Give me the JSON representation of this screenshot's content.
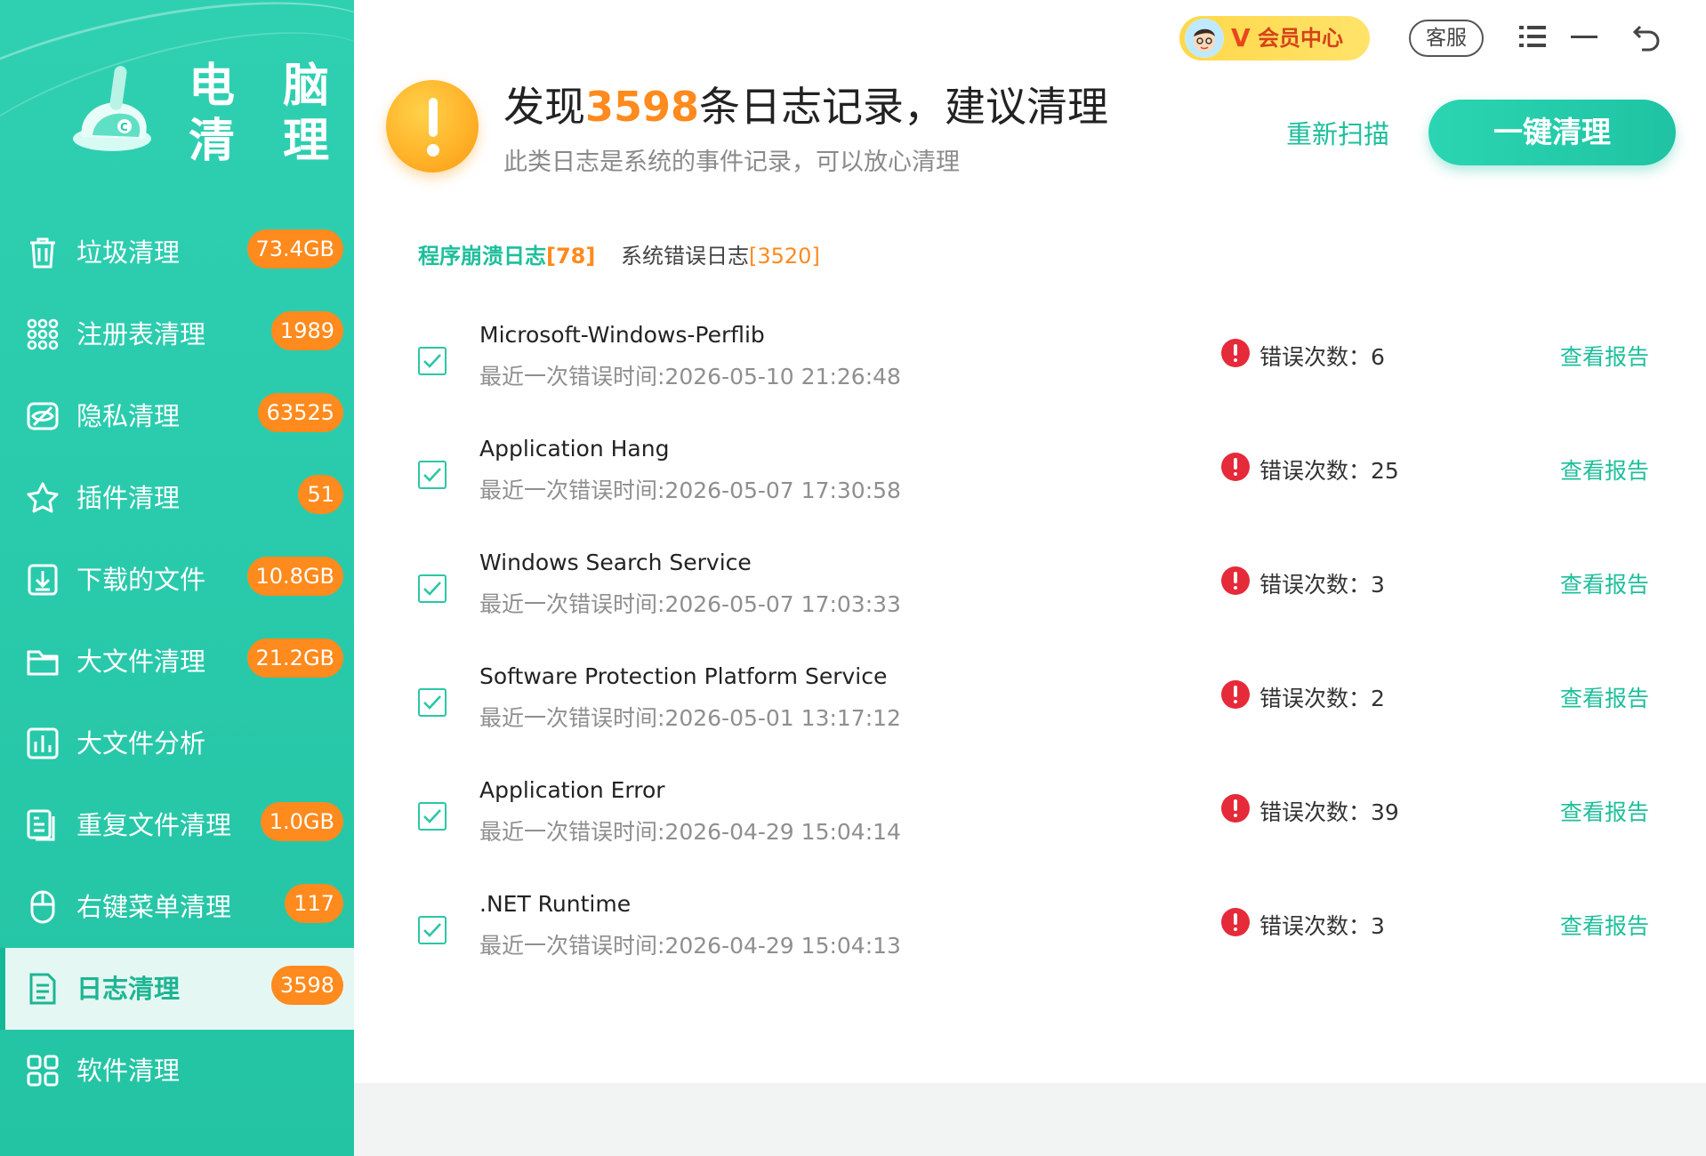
{
  "app": {
    "logo_text_line1": "电 脑",
    "logo_text_line2": "清 理"
  },
  "sidebar": {
    "items": [
      {
        "label": "垃圾清理",
        "badge": "73.4GB",
        "icon": "trash-icon"
      },
      {
        "label": "注册表清理",
        "badge": "1989",
        "icon": "registry-grid-icon"
      },
      {
        "label": "隐私清理",
        "badge": "63525",
        "icon": "privacy-eye-icon"
      },
      {
        "label": "插件清理",
        "badge": "51",
        "icon": "puzzle-icon"
      },
      {
        "label": "下载的文件",
        "badge": "10.8GB",
        "icon": "download-icon"
      },
      {
        "label": "大文件清理",
        "badge": "21.2GB",
        "icon": "folder-icon"
      },
      {
        "label": "大文件分析",
        "badge": "",
        "icon": "bar-chart-icon"
      },
      {
        "label": "重复文件清理",
        "badge": "1.0GB",
        "icon": "duplicate-file-icon"
      },
      {
        "label": "右键菜单清理",
        "badge": "117",
        "icon": "mouse-icon"
      },
      {
        "label": "日志清理",
        "badge": "3598",
        "icon": "log-document-icon",
        "active": true
      },
      {
        "label": "软件清理",
        "badge": "",
        "icon": "apps-grid-icon"
      }
    ]
  },
  "topbar": {
    "vip_mark": "V",
    "vip_label": "会员中心",
    "service_label": "客服",
    "icons": [
      "menu-icon",
      "minimize-icon",
      "back-icon"
    ]
  },
  "header": {
    "headline_prefix": "发现",
    "headline_count": "3598",
    "headline_suffix": "条日志记录，建议清理",
    "subline": "此类日志是系统的事件记录，可以放心清理",
    "rescan_label": "重新扫描",
    "clean_label": "一键清理"
  },
  "tabs": [
    {
      "label": "程序崩溃日志",
      "count": "[78]",
      "active": true
    },
    {
      "label": "系统错误日志",
      "count": "[3520]",
      "active": false
    }
  ],
  "log_rows": [
    {
      "name": "Microsoft-Windows-Perflib",
      "time": "最近一次错误时间:2026-05-10 21:26:48",
      "error_label": "错误次数：6",
      "report_label": "查看报告",
      "checked": true
    },
    {
      "name": "Application Hang",
      "time": "最近一次错误时间:2026-05-07 17:30:58",
      "error_label": "错误次数：25",
      "report_label": "查看报告",
      "checked": true
    },
    {
      "name": "Windows Search Service",
      "time": "最近一次错误时间:2026-05-07 17:03:33",
      "error_label": "错误次数：3",
      "report_label": "查看报告",
      "checked": true
    },
    {
      "name": "Software Protection Platform Service",
      "time": "最近一次错误时间:2026-05-01 13:17:12",
      "error_label": "错误次数：2",
      "report_label": "查看报告",
      "checked": true
    },
    {
      "name": "Application Error",
      "time": "最近一次错误时间:2026-04-29 15:04:14",
      "error_label": "错误次数：39",
      "report_label": "查看报告",
      "checked": true
    },
    {
      "name": ".NET Runtime",
      "time": "最近一次错误时间:2026-04-29 15:04:13",
      "error_label": "错误次数：3",
      "report_label": "查看报告",
      "checked": true
    }
  ],
  "colors": {
    "accent": "#1dbf9b",
    "sidebar": "#27c9a9",
    "badge": "#ff8a1d",
    "error": "#e52a3a",
    "warning": "#ffb42a"
  }
}
